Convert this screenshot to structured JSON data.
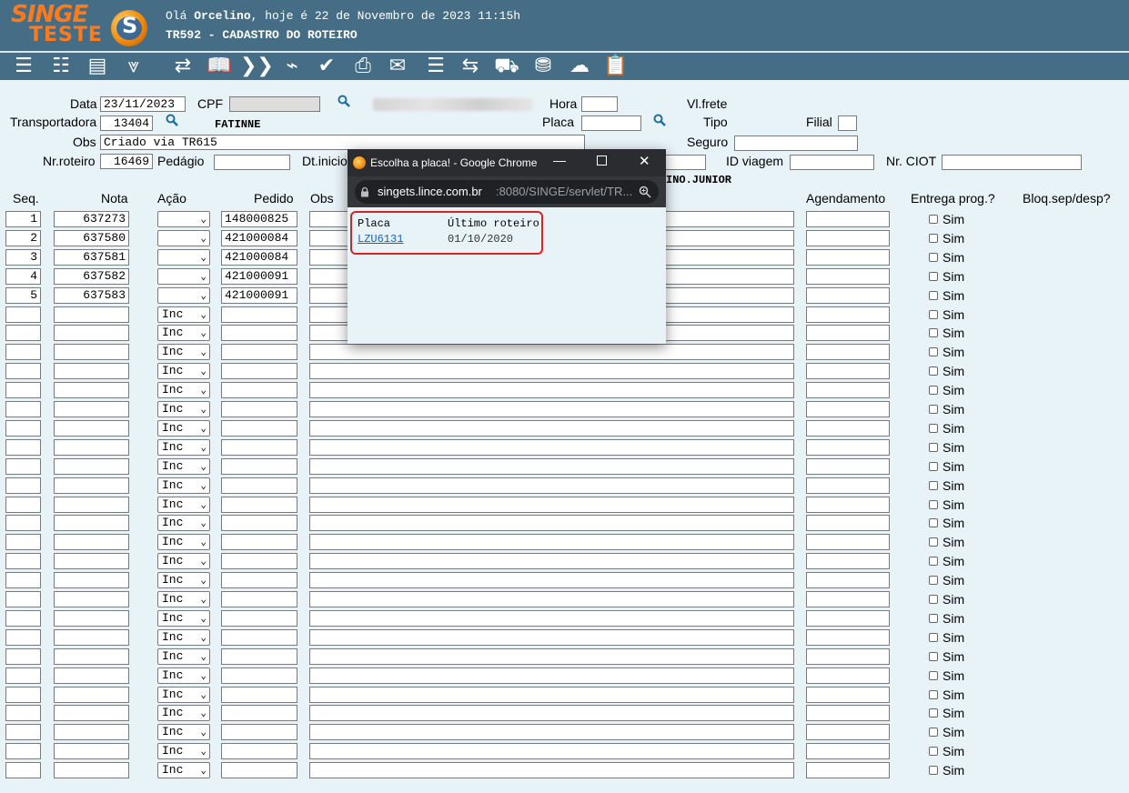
{
  "header": {
    "logo_text": "SINGE",
    "logo_sub": "TESTE",
    "greeting_prefix": "Olá ",
    "user": "Orcelino",
    "greeting_suffix": ", hoje é 22 de Novembro de 2023 11:15h",
    "screen_title": "TR592 - CADASTRO DO ROTEIRO"
  },
  "toolbar": [
    "list-icon",
    "checklist-icon",
    "form-icon",
    "chevrons-down-icon",
    "refresh-icon",
    "book-icon",
    "fast-forward-icon",
    "broom-icon",
    "check-icon",
    "printer-icon",
    "email-icon",
    "tasks-icon",
    "swap-icon",
    "truck-icon",
    "disk-icon",
    "cloud-upload-icon",
    "clipboard-icon"
  ],
  "form": {
    "data_label": "Data",
    "data_value": "23/11/2023",
    "cpf_label": "CPF",
    "hora_label": "Hora",
    "vlfrete_label": "Vl.frete",
    "transportadora_label": "Transportadora",
    "transportadora_value": "13404",
    "transportadora_name": "FATINNE",
    "placa_label": "Placa",
    "tipo_label": "Tipo",
    "filial_label": "Filial",
    "obs_label": "Obs",
    "obs_value": "Criado via TR615",
    "seguro_label": "Seguro",
    "nrroteiro_label": "Nr.roteiro",
    "nrroteiro_value": "16469",
    "pedagio_label": "Pedágio",
    "dtinicio_label": "Dt.inicio",
    "idviagem_label": "ID viagem",
    "nrciot_label": "Nr. CIOT",
    "motorista_name_partial": "INO.JUNIOR"
  },
  "table": {
    "headers": {
      "seq": "Seq.",
      "nota": "Nota",
      "acao": "Ação",
      "pedido": "Pedido",
      "obs": "Obs",
      "agendamento": "Agendamento",
      "entrega": "Entrega prog.?",
      "bloq": "Bloq.sep/desp?"
    },
    "filled_rows": [
      {
        "seq": "1",
        "nota": "637273",
        "acao": "",
        "pedido": "148000825"
      },
      {
        "seq": "2",
        "nota": "637580",
        "acao": "",
        "pedido": "421000084"
      },
      {
        "seq": "3",
        "nota": "637581",
        "acao": "",
        "pedido": "421000084"
      },
      {
        "seq": "4",
        "nota": "637582",
        "acao": "",
        "pedido": "421000091"
      },
      {
        "seq": "5",
        "nota": "637583",
        "acao": "",
        "pedido": "421000091"
      }
    ],
    "empty_row_action": "Inc",
    "sim_label": "Sim"
  },
  "popup": {
    "window_title": "Escolha a placa! - Google Chrome",
    "url_host": "singets.lince.com.br",
    "url_rest": ":8080/SINGE/servlet/TR...",
    "col_placa": "Placa",
    "col_ultimo": "Último roteiro",
    "rows": [
      {
        "placa": "LZU6131",
        "ultimo": "01/10/2020"
      }
    ]
  },
  "colors": {
    "header_bg": "#456e86",
    "page_bg": "#e8f3f8",
    "logo": "#ff7a1a",
    "highlight": "#e02020",
    "link": "#1a5fb4"
  }
}
